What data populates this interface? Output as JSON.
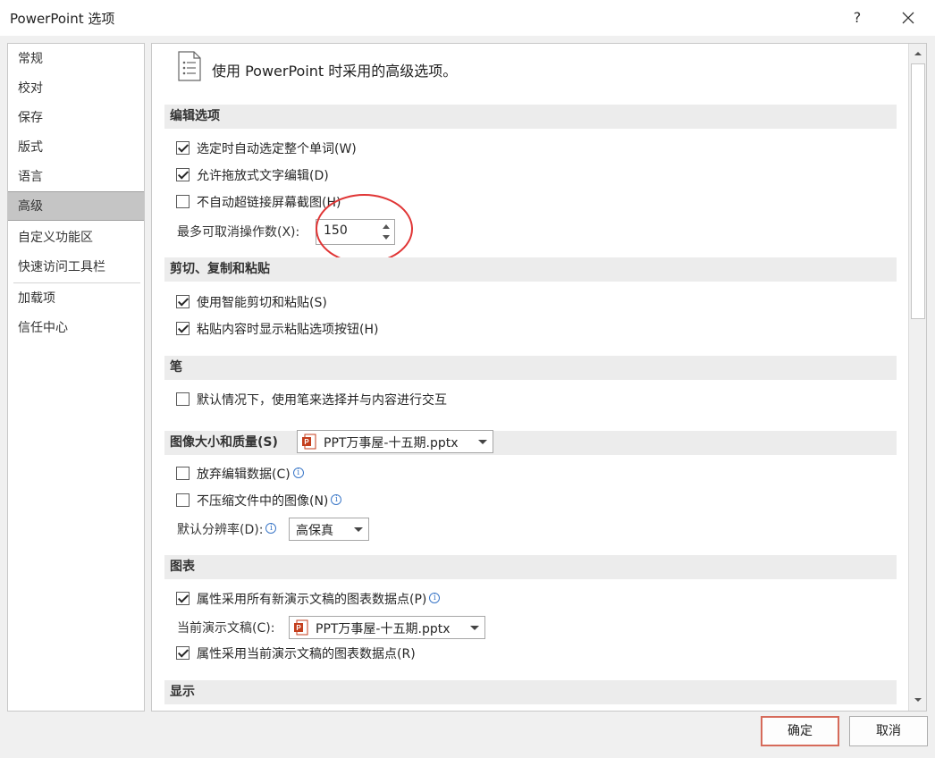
{
  "window": {
    "title": "PowerPoint 选项",
    "help_label": "?"
  },
  "nav": {
    "items": [
      "常规",
      "校对",
      "保存",
      "版式",
      "语言",
      "高级",
      "自定义功能区",
      "快速访问工具栏",
      "加载项",
      "信任中心"
    ],
    "selected": "高级"
  },
  "header": {
    "text": "使用 PowerPoint 时采用的高级选项。"
  },
  "editing": {
    "title": "编辑选项",
    "opt1": {
      "label": "选定时自动选定整个单词(W)",
      "checked": true
    },
    "opt2": {
      "label": "允许拖放式文字编辑(D)",
      "checked": true
    },
    "opt3": {
      "label": "不自动超链接屏幕截图(H)",
      "checked": false
    },
    "undo_label": "最多可取消操作数(X):",
    "undo_value": "150"
  },
  "clipboard": {
    "title": "剪切、复制和粘贴",
    "opt1": {
      "label": "使用智能剪切和粘贴(S)",
      "checked": true
    },
    "opt2": {
      "label": "粘贴内容时显示粘贴选项按钮(H)",
      "checked": true
    }
  },
  "pen": {
    "title": "笔",
    "opt1": {
      "label": "默认情况下，使用笔来选择并与内容进行交互",
      "checked": false
    }
  },
  "image": {
    "title": "图像大小和质量(S)",
    "file": "PPT万事屋-十五期.pptx",
    "opt1": {
      "label": "放弃编辑数据(C)",
      "checked": false
    },
    "opt2": {
      "label": "不压缩文件中的图像(N)",
      "checked": false
    },
    "resolution_label": "默认分辨率(D):",
    "resolution_value": "高保真"
  },
  "chart": {
    "title": "图表",
    "opt1": {
      "label": "属性采用所有新演示文稿的图表数据点(P)",
      "checked": true
    },
    "current_label": "当前演示文稿(C):",
    "current_file": "PPT万事屋-十五期.pptx",
    "opt2": {
      "label": "属性采用当前演示文稿的图表数据点(R)",
      "checked": true
    }
  },
  "display": {
    "title": "显示"
  },
  "footer": {
    "ok": "确定",
    "cancel": "取消"
  },
  "colors": {
    "accent_red": "#e03535",
    "ppt_icon": "#c43e1c",
    "info_blue": "#3c78c8"
  }
}
